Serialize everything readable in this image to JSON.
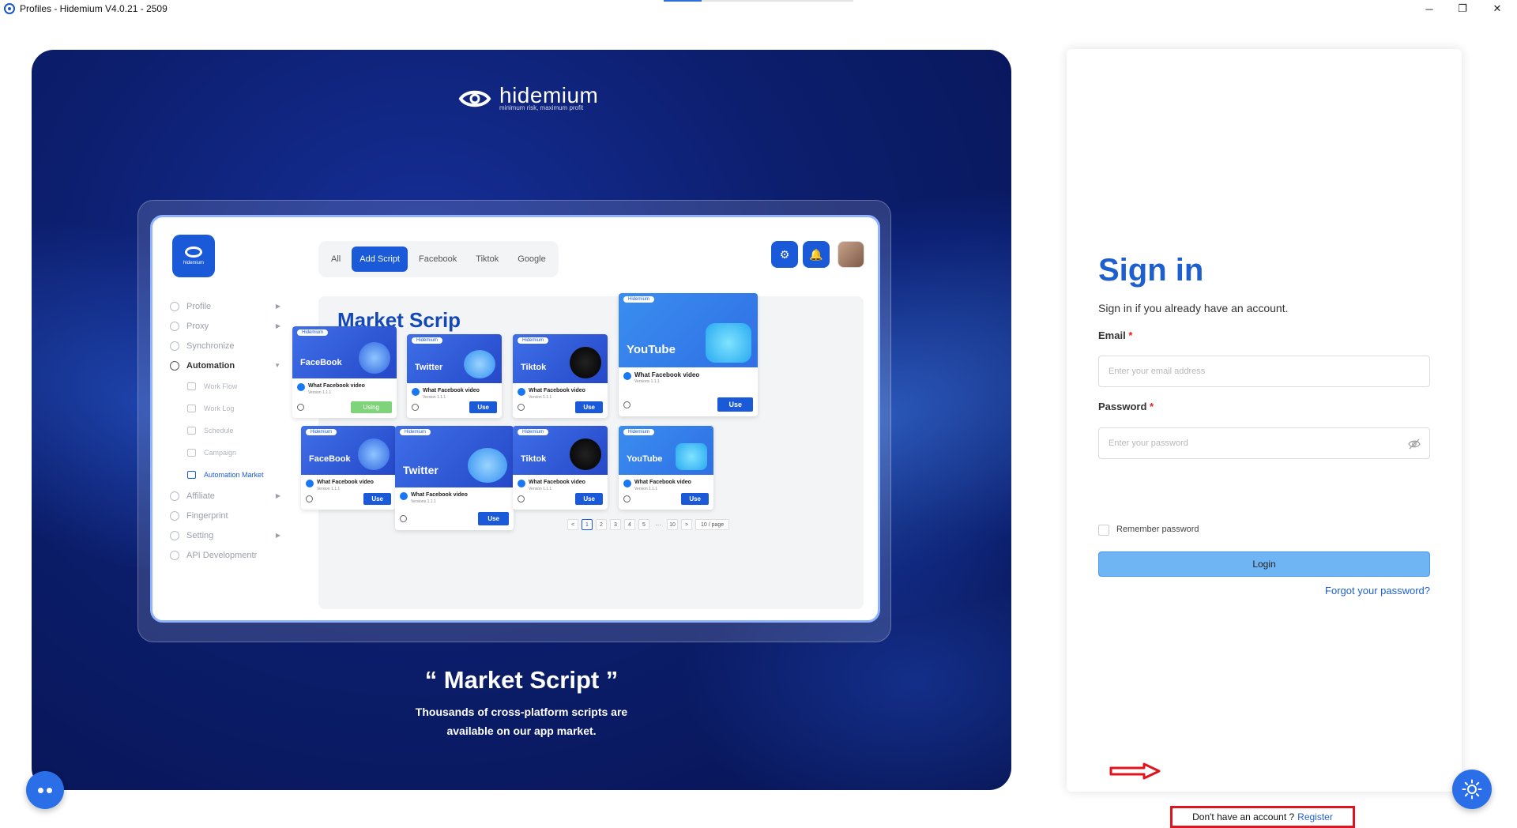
{
  "window": {
    "title": "Profiles - Hidemium V4.0.21 - 2509",
    "minimize": "─",
    "restore": "❐",
    "close": "✕"
  },
  "brand": {
    "name": "hidemium",
    "tagline": "minimum risk, maximum profit"
  },
  "mockup": {
    "logo_text": "hidemium",
    "filters": [
      "All",
      "Add Script",
      "Facebook",
      "Tiktok",
      "Google"
    ],
    "active_filter": "Add Script",
    "sidebar": [
      {
        "label": "Profile",
        "arrow": "▶"
      },
      {
        "label": "Proxy",
        "arrow": "▶"
      },
      {
        "label": "Synchronize",
        "arrow": ""
      },
      {
        "label": "Automation",
        "arrow": "▼"
      }
    ],
    "sub_items": [
      "Work Flow",
      "Work Log",
      "Schedule",
      "Campaign",
      "Automation Market"
    ],
    "sidebar_bottom": [
      {
        "label": "Affiliate",
        "arrow": "▶"
      },
      {
        "label": "Fingerprint",
        "arrow": ""
      },
      {
        "label": "Setting",
        "arrow": "▶"
      },
      {
        "label": "API Developmentr",
        "arrow": ""
      }
    ],
    "market_title": "Market Scrip",
    "card_pill": "Hidemium",
    "cards": [
      {
        "banner": "FaceBook",
        "title": "What Facebook video",
        "version": "Version 1.1.1",
        "button": "Using"
      },
      {
        "banner": "Twitter",
        "title": "What Facebook video",
        "version": "Version 1.1.1",
        "button": "Use"
      },
      {
        "banner": "Tiktok",
        "title": "What Facebook video",
        "version": "Version 1.1.1",
        "button": "Use"
      },
      {
        "banner": "YouTube",
        "title": "What Facebook video",
        "version": "Versions 1.1.1",
        "button": "Use"
      },
      {
        "banner": "FaceBook",
        "title": "What Facebook video",
        "version": "Version 1.1.1",
        "button": "Use"
      },
      {
        "banner": "Twitter",
        "title": "What Facebook video",
        "version": "Versions 1.1.1",
        "button": "Use"
      },
      {
        "banner": "Tiktok",
        "title": "What Facebook video",
        "version": "Version 1.1.1",
        "button": "Use"
      },
      {
        "banner": "YouTube",
        "title": "What Facebook video",
        "version": "Version 1.1.1",
        "button": "Use"
      }
    ],
    "pagination": {
      "prev": "<",
      "pages": [
        "1",
        "2",
        "3",
        "4",
        "5"
      ],
      "ellipsis": "···",
      "last": "10",
      "next": ">",
      "page_size": "10 / page",
      "current_page": "1"
    }
  },
  "hero": {
    "heading": "“ Market Script ”",
    "subtitle": "Thousands of cross-platform scripts are available on our app market."
  },
  "signin": {
    "title": "Sign in",
    "subtitle": "Sign in if you already have an account.",
    "email_label": "Email",
    "email_placeholder": "Enter your email address",
    "email_value": "",
    "password_label": "Password",
    "password_placeholder": "Enter your password",
    "password_value": "",
    "required_mark": "*",
    "remember_label": "Remember password",
    "remember_checked": false,
    "login_label": "Login",
    "forgot_label": "Forgot your password?",
    "no_account_text": "Don't have an account ?",
    "register_label": "Register"
  },
  "colors": {
    "accent": "#1e5fd0",
    "login_button": "#6fb5f3",
    "highlight_box": "#e0141e",
    "hero_background": "#0c1e6e"
  },
  "icons": {
    "chat": "chat-bubble-icon",
    "theme": "sun-icon",
    "password_toggle": "eye-slash-icon",
    "annotation": "red-arrow-icon"
  }
}
